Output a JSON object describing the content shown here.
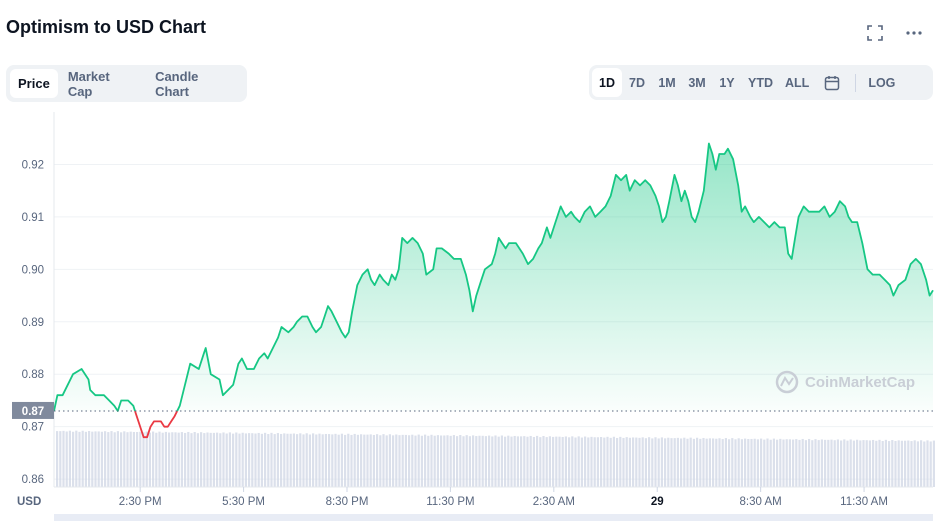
{
  "header": {
    "title": "Optimism to USD Chart"
  },
  "tabs": [
    {
      "label": "Price",
      "active": true
    },
    {
      "label": "Market Cap",
      "active": false
    },
    {
      "label": "Candle Chart",
      "active": false
    }
  ],
  "ranges": [
    {
      "label": "1D",
      "active": true
    },
    {
      "label": "7D",
      "active": false
    },
    {
      "label": "1M",
      "active": false
    },
    {
      "label": "3M",
      "active": false
    },
    {
      "label": "1Y",
      "active": false
    },
    {
      "label": "YTD",
      "active": false
    },
    {
      "label": "ALL",
      "active": false
    }
  ],
  "log_label": "LOG",
  "watermark": "CoinMarketCap",
  "colors": {
    "up": "#16c784",
    "down": "#ea3943",
    "ref_label_bg": "#808a9d",
    "volume": "#cfd6e4",
    "grid": "#eff2f5"
  },
  "chart_data": {
    "type": "area",
    "currency_label": "USD",
    "reference_price": 0.873,
    "reference_label": "0.87",
    "y_ticks": [
      0.86,
      0.87,
      0.88,
      0.89,
      0.9,
      0.91,
      0.92
    ],
    "y_tick_labels": [
      "0.86",
      "0.87",
      "0.88",
      "0.89",
      "0.90",
      "0.91",
      "0.92"
    ],
    "ylim": [
      0.8585,
      0.93
    ],
    "x_tick_labels": [
      "2:30 PM",
      "5:30 PM",
      "8:30 PM",
      "11:30 PM",
      "2:30 AM",
      "29",
      "8:30 AM",
      "11:30 AM"
    ],
    "x_tick_bold": [
      false,
      false,
      false,
      false,
      false,
      true,
      false,
      false
    ],
    "x_tick_hours": [
      2.5,
      5.5,
      8.5,
      11.5,
      14.5,
      17.5,
      20.5,
      23.5
    ],
    "x_range_hours": [
      0,
      24
    ],
    "series": [
      {
        "values": [
          [
            0.0,
            0.873
          ],
          [
            0.1,
            0.876
          ],
          [
            0.25,
            0.876
          ],
          [
            0.4,
            0.878
          ],
          [
            0.55,
            0.88
          ],
          [
            0.8,
            0.881
          ],
          [
            1.0,
            0.879
          ],
          [
            1.05,
            0.877
          ],
          [
            1.2,
            0.876
          ],
          [
            1.45,
            0.876
          ],
          [
            1.6,
            0.875
          ],
          [
            1.75,
            0.874
          ],
          [
            1.85,
            0.873
          ],
          [
            1.95,
            0.875
          ],
          [
            2.15,
            0.875
          ],
          [
            2.3,
            0.874
          ],
          [
            2.4,
            0.872
          ],
          [
            2.55,
            0.869
          ],
          [
            2.6,
            0.868
          ],
          [
            2.7,
            0.868
          ],
          [
            2.8,
            0.87
          ],
          [
            2.9,
            0.871
          ],
          [
            3.1,
            0.871
          ],
          [
            3.2,
            0.87
          ],
          [
            3.3,
            0.87
          ],
          [
            3.4,
            0.871
          ],
          [
            3.5,
            0.872
          ],
          [
            3.65,
            0.874
          ],
          [
            3.8,
            0.878
          ],
          [
            3.95,
            0.882
          ],
          [
            4.2,
            0.881
          ],
          [
            4.35,
            0.884
          ],
          [
            4.4,
            0.885
          ],
          [
            4.55,
            0.88
          ],
          [
            4.8,
            0.879
          ],
          [
            4.9,
            0.876
          ],
          [
            5.05,
            0.877
          ],
          [
            5.2,
            0.878
          ],
          [
            5.35,
            0.882
          ],
          [
            5.45,
            0.883
          ],
          [
            5.6,
            0.881
          ],
          [
            5.8,
            0.881
          ],
          [
            5.95,
            0.883
          ],
          [
            6.1,
            0.884
          ],
          [
            6.2,
            0.883
          ],
          [
            6.35,
            0.885
          ],
          [
            6.5,
            0.887
          ],
          [
            6.6,
            0.889
          ],
          [
            6.8,
            0.888
          ],
          [
            6.95,
            0.889
          ],
          [
            7.05,
            0.89
          ],
          [
            7.2,
            0.891
          ],
          [
            7.35,
            0.891
          ],
          [
            7.5,
            0.889
          ],
          [
            7.6,
            0.888
          ],
          [
            7.75,
            0.889
          ],
          [
            7.85,
            0.891
          ],
          [
            7.95,
            0.893
          ],
          [
            8.05,
            0.892
          ],
          [
            8.2,
            0.89
          ],
          [
            8.35,
            0.888
          ],
          [
            8.45,
            0.887
          ],
          [
            8.55,
            0.888
          ],
          [
            8.65,
            0.892
          ],
          [
            8.8,
            0.897
          ],
          [
            8.95,
            0.899
          ],
          [
            9.1,
            0.9
          ],
          [
            9.2,
            0.898
          ],
          [
            9.3,
            0.897
          ],
          [
            9.45,
            0.899
          ],
          [
            9.55,
            0.898
          ],
          [
            9.7,
            0.897
          ],
          [
            9.8,
            0.899
          ],
          [
            9.9,
            0.898
          ],
          [
            10.0,
            0.9
          ],
          [
            10.1,
            0.906
          ],
          [
            10.25,
            0.905
          ],
          [
            10.4,
            0.906
          ],
          [
            10.55,
            0.905
          ],
          [
            10.7,
            0.903
          ],
          [
            10.8,
            0.899
          ],
          [
            11.0,
            0.9
          ],
          [
            11.1,
            0.904
          ],
          [
            11.25,
            0.904
          ],
          [
            11.45,
            0.903
          ],
          [
            11.6,
            0.902
          ],
          [
            11.8,
            0.902
          ],
          [
            11.95,
            0.899
          ],
          [
            12.05,
            0.896
          ],
          [
            12.15,
            0.892
          ],
          [
            12.25,
            0.895
          ],
          [
            12.4,
            0.898
          ],
          [
            12.5,
            0.9
          ],
          [
            12.7,
            0.901
          ],
          [
            12.8,
            0.903
          ],
          [
            12.9,
            0.906
          ],
          [
            13.0,
            0.905
          ],
          [
            13.1,
            0.904
          ],
          [
            13.2,
            0.905
          ],
          [
            13.4,
            0.905
          ],
          [
            13.6,
            0.903
          ],
          [
            13.75,
            0.901
          ],
          [
            13.9,
            0.902
          ],
          [
            14.05,
            0.904
          ],
          [
            14.15,
            0.905
          ],
          [
            14.3,
            0.908
          ],
          [
            14.4,
            0.906
          ],
          [
            14.55,
            0.909
          ],
          [
            14.7,
            0.912
          ],
          [
            14.85,
            0.91
          ],
          [
            15.0,
            0.911
          ],
          [
            15.1,
            0.91
          ],
          [
            15.25,
            0.909
          ],
          [
            15.4,
            0.911
          ],
          [
            15.55,
            0.912
          ],
          [
            15.7,
            0.91
          ],
          [
            15.85,
            0.911
          ],
          [
            16.0,
            0.912
          ],
          [
            16.15,
            0.914
          ],
          [
            16.3,
            0.918
          ],
          [
            16.45,
            0.917
          ],
          [
            16.6,
            0.918
          ],
          [
            16.7,
            0.915
          ],
          [
            16.85,
            0.917
          ],
          [
            17.0,
            0.916
          ],
          [
            17.15,
            0.917
          ],
          [
            17.3,
            0.916
          ],
          [
            17.45,
            0.914
          ],
          [
            17.55,
            0.912
          ],
          [
            17.65,
            0.909
          ],
          [
            17.75,
            0.91
          ],
          [
            17.85,
            0.913
          ],
          [
            18.0,
            0.918
          ],
          [
            18.1,
            0.916
          ],
          [
            18.2,
            0.913
          ],
          [
            18.3,
            0.915
          ],
          [
            18.4,
            0.913
          ],
          [
            18.5,
            0.91
          ],
          [
            18.6,
            0.909
          ],
          [
            18.7,
            0.911
          ],
          [
            18.85,
            0.915
          ],
          [
            19.0,
            0.924
          ],
          [
            19.1,
            0.922
          ],
          [
            19.2,
            0.919
          ],
          [
            19.3,
            0.922
          ],
          [
            19.45,
            0.922
          ],
          [
            19.55,
            0.923
          ],
          [
            19.7,
            0.921
          ],
          [
            19.85,
            0.916
          ],
          [
            19.95,
            0.911
          ],
          [
            20.05,
            0.912
          ],
          [
            20.2,
            0.91
          ],
          [
            20.3,
            0.909
          ],
          [
            20.45,
            0.91
          ],
          [
            20.6,
            0.909
          ],
          [
            20.75,
            0.908
          ],
          [
            20.9,
            0.909
          ],
          [
            21.05,
            0.908
          ],
          [
            21.2,
            0.908
          ],
          [
            21.3,
            0.903
          ],
          [
            21.4,
            0.902
          ],
          [
            21.5,
            0.906
          ],
          [
            21.6,
            0.91
          ],
          [
            21.75,
            0.912
          ],
          [
            21.9,
            0.911
          ],
          [
            22.05,
            0.911
          ],
          [
            22.2,
            0.911
          ],
          [
            22.35,
            0.912
          ],
          [
            22.5,
            0.91
          ],
          [
            22.65,
            0.911
          ],
          [
            22.8,
            0.913
          ],
          [
            22.95,
            0.912
          ],
          [
            23.05,
            0.91
          ],
          [
            23.15,
            0.909
          ],
          [
            23.3,
            0.909
          ],
          [
            23.45,
            0.905
          ],
          [
            23.6,
            0.9
          ],
          [
            23.75,
            0.899
          ],
          [
            23.95,
            0.899
          ],
          [
            24.1,
            0.898
          ],
          [
            24.25,
            0.897
          ],
          [
            24.35,
            0.895
          ],
          [
            24.5,
            0.897
          ],
          [
            24.7,
            0.898
          ],
          [
            24.85,
            0.901
          ],
          [
            25.0,
            0.902
          ],
          [
            25.15,
            0.901
          ],
          [
            25.3,
            0.898
          ],
          [
            25.4,
            0.895
          ],
          [
            25.5,
            0.896
          ]
        ]
      }
    ],
    "volume_hint": "background volume bars, roughly constant"
  }
}
